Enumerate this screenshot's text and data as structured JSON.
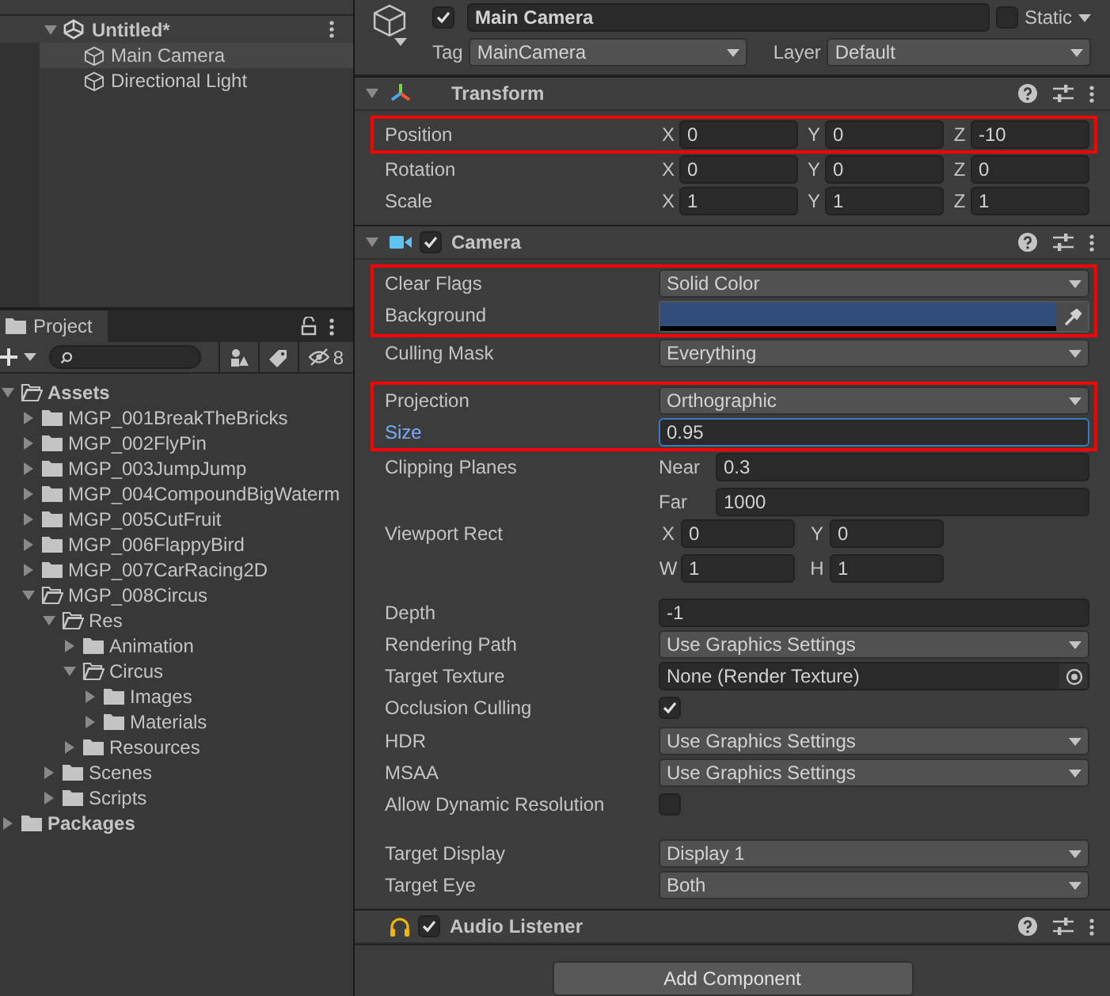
{
  "hierarchy": {
    "scene": {
      "name": "Untitled*",
      "expanded": true,
      "children": [
        {
          "label": "Main Camera",
          "selected": true
        },
        {
          "label": "Directional Light",
          "selected": false
        }
      ]
    }
  },
  "project": {
    "tab": "Project",
    "hidden_count": "8",
    "tree": [
      {
        "label": "Assets",
        "expanded": true,
        "children": [
          {
            "label": "MGP_001BreakTheBricks",
            "expanded": false
          },
          {
            "label": "MGP_002FlyPin",
            "expanded": false
          },
          {
            "label": "MGP_003JumpJump",
            "expanded": false
          },
          {
            "label": "MGP_004CompoundBigWaterm",
            "expanded": false
          },
          {
            "label": "MGP_005CutFruit",
            "expanded": false
          },
          {
            "label": "MGP_006FlappyBird",
            "expanded": false
          },
          {
            "label": "MGP_007CarRacing2D",
            "expanded": false
          },
          {
            "label": "MGP_008Circus",
            "expanded": true,
            "children": [
              {
                "label": "Res",
                "expanded": true,
                "children": [
                  {
                    "label": "Animation",
                    "expanded": false
                  },
                  {
                    "label": "Circus",
                    "expanded": true,
                    "children": [
                      {
                        "label": "Images",
                        "expanded": false
                      },
                      {
                        "label": "Materials",
                        "expanded": false
                      }
                    ]
                  },
                  {
                    "label": "Resources",
                    "expanded": false
                  }
                ]
              },
              {
                "label": "Scenes",
                "expanded": false
              },
              {
                "label": "Scripts",
                "expanded": false
              }
            ]
          }
        ]
      },
      {
        "label": "Packages",
        "expanded": false
      }
    ]
  },
  "inspector": {
    "object": {
      "active": true,
      "name": "Main Camera",
      "static": false,
      "static_label": "Static",
      "tag_label": "Tag",
      "tag": "MainCamera",
      "layer_label": "Layer",
      "layer": "Default"
    },
    "components": [
      {
        "kind": "transform",
        "title": "Transform",
        "expanded": true,
        "rows": [
          {
            "kind": "vector",
            "label": "Position",
            "highlight": true,
            "items": [
              {
                "label": "X",
                "value": "0"
              },
              {
                "label": "Y",
                "value": "0"
              },
              {
                "label": "Z",
                "value": "-10"
              }
            ]
          },
          {
            "kind": "vector",
            "label": "Rotation",
            "items": [
              {
                "label": "X",
                "value": "0"
              },
              {
                "label": "Y",
                "value": "0"
              },
              {
                "label": "Z",
                "value": "0"
              }
            ]
          },
          {
            "kind": "vector",
            "label": "Scale",
            "items": [
              {
                "label": "X",
                "value": "1"
              },
              {
                "label": "Y",
                "value": "1"
              },
              {
                "label": "Z",
                "value": "1"
              }
            ]
          }
        ]
      },
      {
        "kind": "camera",
        "title": "Camera",
        "expanded": true,
        "enabled": true,
        "rows": [
          {
            "kind": "dropdown",
            "label": "Clear Flags",
            "value": "Solid Color",
            "highlight": true
          },
          {
            "kind": "color",
            "label": "Background",
            "color": "#314d7a",
            "highlight": true
          },
          {
            "kind": "dropdown",
            "label": "Culling Mask",
            "value": "Everything"
          },
          {
            "kind": "dropdown",
            "label": "Projection",
            "value": "Orthographic",
            "spaced": true,
            "highlight": true
          },
          {
            "kind": "number",
            "label": "Size",
            "value": "0.95",
            "focused": true,
            "highlight": true
          },
          {
            "kind": "fields",
            "label": "Clipping Planes",
            "items": [
              {
                "label": "Near",
                "value": "0.3"
              },
              {
                "label": "Far",
                "value": "1000"
              }
            ]
          },
          {
            "kind": "rect",
            "label": "Viewport Rect",
            "items": [
              {
                "label": "X",
                "value": "0"
              },
              {
                "label": "Y",
                "value": "0"
              },
              {
                "label": "W",
                "value": "1"
              },
              {
                "label": "H",
                "value": "1"
              }
            ]
          },
          {
            "kind": "number",
            "label": "Depth",
            "value": "-1",
            "spaced": true
          },
          {
            "kind": "dropdown",
            "label": "Rendering Path",
            "value": "Use Graphics Settings"
          },
          {
            "kind": "object",
            "label": "Target Texture",
            "value": "None (Render Texture)"
          },
          {
            "kind": "checkbox",
            "label": "Occlusion Culling",
            "checked": true
          },
          {
            "kind": "dropdown",
            "label": "HDR",
            "value": "Use Graphics Settings"
          },
          {
            "kind": "dropdown",
            "label": "MSAA",
            "value": "Use Graphics Settings"
          },
          {
            "kind": "checkbox",
            "label": "Allow Dynamic Resolution",
            "checked": false
          },
          {
            "kind": "dropdown",
            "label": "Target Display",
            "value": "Display 1",
            "spaced": true
          },
          {
            "kind": "dropdown",
            "label": "Target Eye",
            "value": "Both"
          }
        ]
      },
      {
        "kind": "audio",
        "title": "Audio Listener",
        "enabled": true
      }
    ],
    "add_button": "Add Component"
  }
}
